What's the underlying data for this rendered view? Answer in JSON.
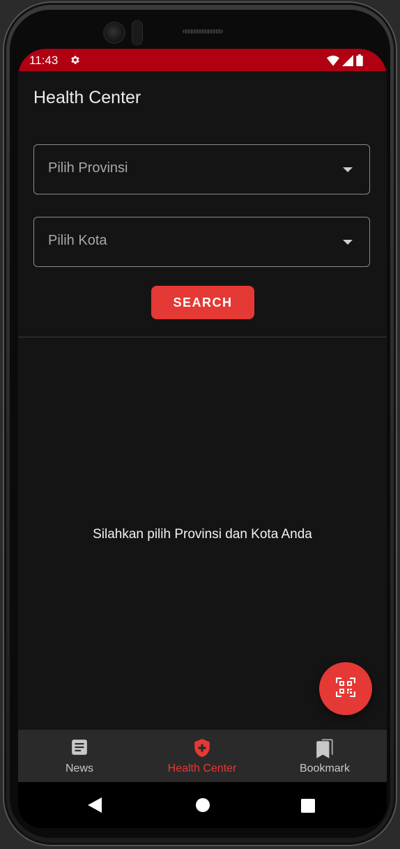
{
  "status_bar": {
    "time": "11:43",
    "icons": [
      "settings-icon",
      "wifi-icon",
      "signal-icon",
      "battery-icon"
    ]
  },
  "app_bar": {
    "title": "Health Center"
  },
  "form": {
    "province_placeholder": "Pilih Provinsi",
    "city_placeholder": "Pilih Kota",
    "search_label": "SEARCH"
  },
  "empty_state": {
    "message": "Silahkan pilih Provinsi dan Kota Anda"
  },
  "fab": {
    "icon": "qr-scan-icon"
  },
  "bottom_nav": {
    "items": [
      {
        "label": "News",
        "icon": "news-icon",
        "active": false
      },
      {
        "label": "Health Center",
        "icon": "health-shield-icon",
        "active": true
      },
      {
        "label": "Bookmark",
        "icon": "bookmark-icon",
        "active": false
      }
    ]
  },
  "system_nav": {
    "icons": [
      "back-icon",
      "home-icon",
      "recents-icon"
    ]
  },
  "colors": {
    "status_bar": "#b00012",
    "accent": "#e53935",
    "background": "#141414",
    "nav_background": "#2a2a2a",
    "nav_inactive": "#c8c8c8"
  }
}
